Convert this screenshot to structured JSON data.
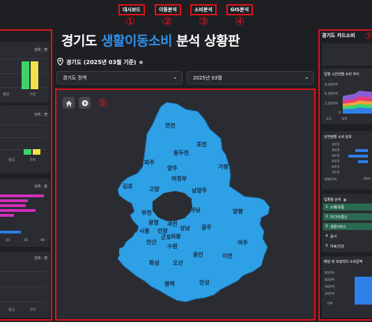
{
  "nav": {
    "tabs": [
      "대시보드",
      "이동분석",
      "소비분석",
      "GIS분석"
    ],
    "circles": [
      "①",
      "②",
      "③",
      "④"
    ]
  },
  "title": {
    "prefix": "경기도 ",
    "accent": "생활이동소비",
    "suffix": " 분석 상황판",
    "accent_color": "#2f8fe8"
  },
  "region": {
    "label": "경기도 (2025년 03월 기준)"
  },
  "filters": {
    "area": "경기도 전역",
    "month": "2025년 03월"
  },
  "map": {
    "marker": "⑤",
    "cities": [
      "연천",
      "포천",
      "동두천",
      "파주",
      "양주",
      "가평",
      "의정부",
      "고양",
      "김포",
      "남양주",
      "구리",
      "하남",
      "양평",
      "부천",
      "광명",
      "시흥",
      "안양",
      "과천",
      "성남",
      "광주",
      "안산",
      "군포",
      "의왕",
      "수원",
      "여주",
      "화성",
      "용인",
      "이천",
      "오산",
      "평택",
      "안성"
    ]
  },
  "left": {
    "units": [
      "단위 : 명",
      "단위 : 명",
      "단위 : 분",
      "단위 : 명"
    ],
    "p1_label": "기타",
    "p1_label2": "병원",
    "p2_labels": [
      "항공",
      "기타"
    ],
    "p3_ticks": [
      "20",
      "30",
      "40"
    ],
    "p4_labels": [
      "항공",
      "기타"
    ]
  },
  "right": {
    "title": "경기도 카드소비",
    "marker": "⑦",
    "s1_title": "일별 시간대별 소비 추이",
    "s1_y": [
      "9,000억",
      "6,000억",
      "3,000억",
      "0"
    ],
    "s1_x": [
      "3/1",
      "3/4"
    ],
    "s2_title": "성연령별 소비 분포",
    "s2_y": [
      "20대",
      "30대",
      "40대",
      "50대",
      "60대",
      "70대"
    ],
    "s2_x": [
      "8965억",
      "600"
    ],
    "s3_title": "업종별 순위",
    "ranks": [
      {
        "n": "1",
        "label": "소매/유통"
      },
      {
        "n": "2",
        "label": "미디어/통신"
      },
      {
        "n": "3",
        "label": "생활서비스"
      },
      {
        "n": "4",
        "label": "음식"
      },
      {
        "n": "5",
        "label": "의료/건강"
      }
    ],
    "s4_title": "배달 및 모빌리티 소비금액",
    "s4_y": [
      "800억",
      "600억",
      "400억",
      "200억",
      "0억"
    ]
  },
  "colors": {
    "accent": "#2f8fe8",
    "red": "#e3121b",
    "map": "#2ea0e6",
    "yellow": "#f2e04a",
    "green": "#3fd36a",
    "magenta": "#d42dbd",
    "blue": "#2f7fe8"
  }
}
